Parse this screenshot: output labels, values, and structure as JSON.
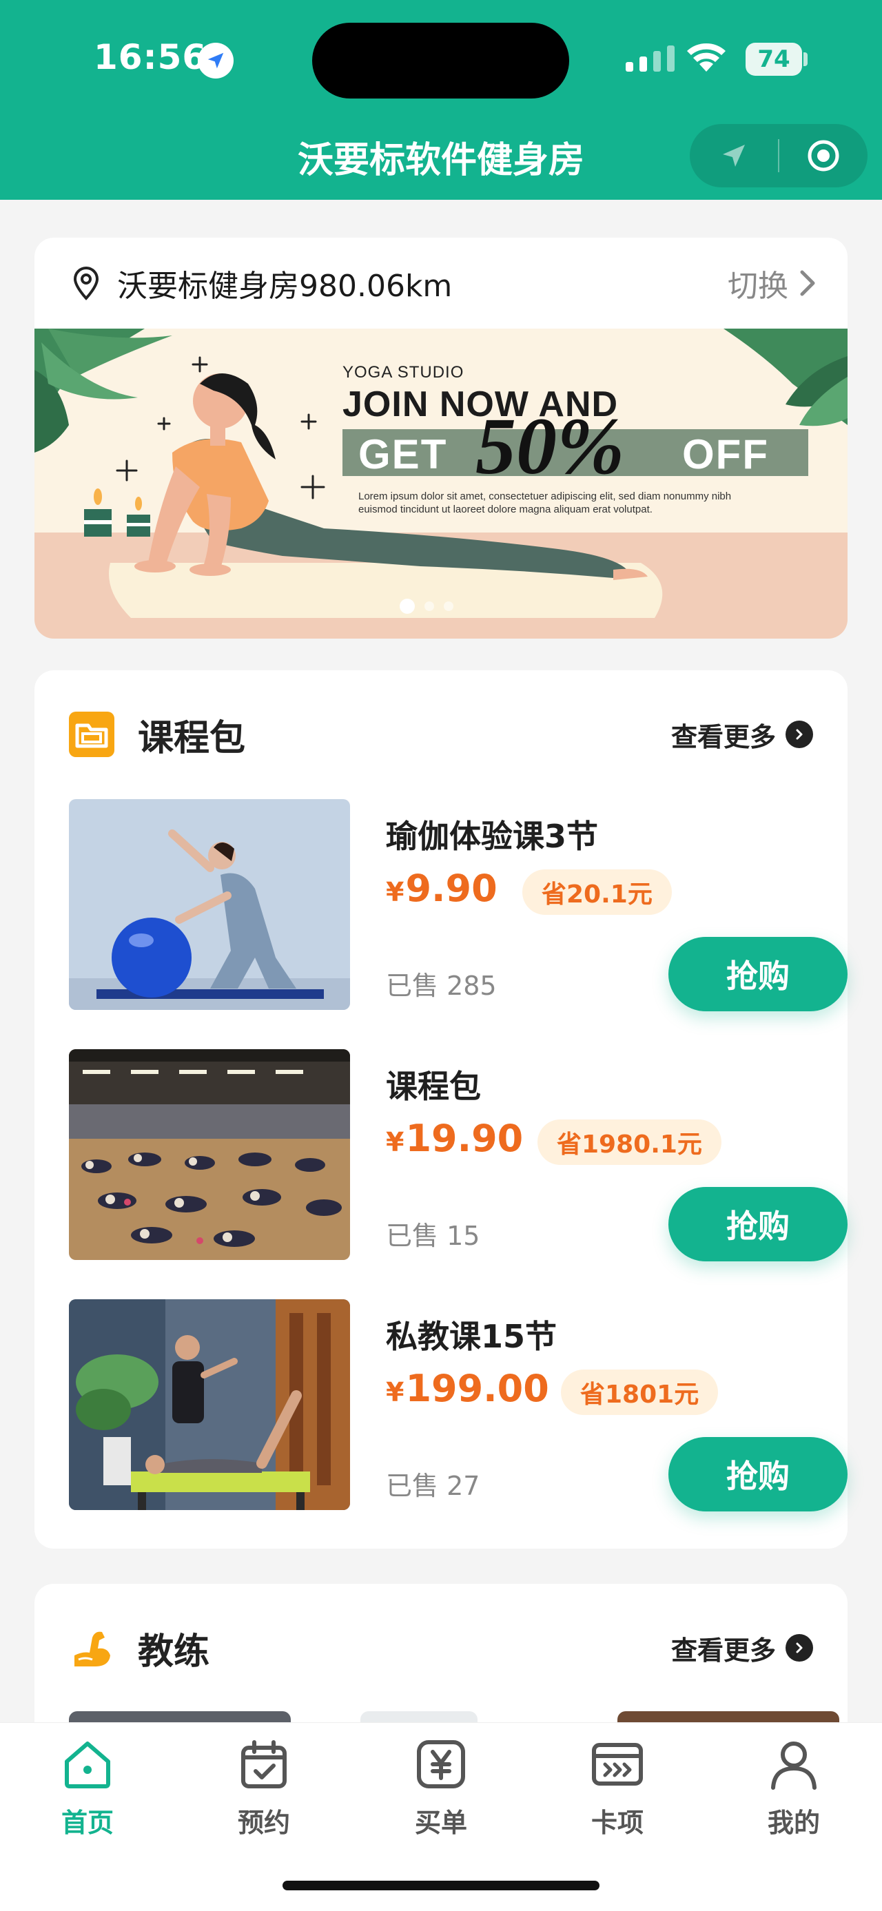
{
  "status_bar": {
    "time": "16:56",
    "battery": "74"
  },
  "nav": {
    "title": "沃要标软件健身房"
  },
  "location": {
    "name": "沃要标健身房980.06km",
    "switch_label": "切换"
  },
  "banner": {
    "studio": "YOGA STUDIO",
    "line1": "JOIN NOW AND",
    "get": "GET",
    "percent": "50%",
    "off": "OFF",
    "lorem": "Lorem ipsum dolor sit amet, consectetuer adipiscing elit, sed diam nonummy nibh euismod tincidunt ut laoreet dolore magna aliquam erat volutpat."
  },
  "course_section": {
    "title": "课程包",
    "more_label": "查看更多",
    "items": [
      {
        "name": "瑜伽体验课3节",
        "currency": "¥",
        "price": "9.90",
        "save": "省20.1元",
        "sold": "已售 285",
        "buy": "抢购"
      },
      {
        "name": "课程包",
        "currency": "¥",
        "price": "19.90",
        "save": "省1980.1元",
        "sold": "已售 15",
        "buy": "抢购"
      },
      {
        "name": "私教课15节",
        "currency": "¥",
        "price": "199.00",
        "save": "省1801元",
        "sold": "已售 27",
        "buy": "抢购"
      }
    ]
  },
  "coach_section": {
    "title": "教练",
    "more_label": "查看更多"
  },
  "tabbar": {
    "items": [
      {
        "label": "首页",
        "icon": "home-icon",
        "active": true
      },
      {
        "label": "预约",
        "icon": "calendar-check-icon",
        "active": false
      },
      {
        "label": "买单",
        "icon": "yen-bill-icon",
        "active": false
      },
      {
        "label": "卡项",
        "icon": "card-icon",
        "active": false
      },
      {
        "label": "我的",
        "icon": "user-icon",
        "active": false
      }
    ]
  },
  "colors": {
    "primary": "#13b38f",
    "price": "#ee6b1e",
    "save_bg": "#fff1dd"
  }
}
